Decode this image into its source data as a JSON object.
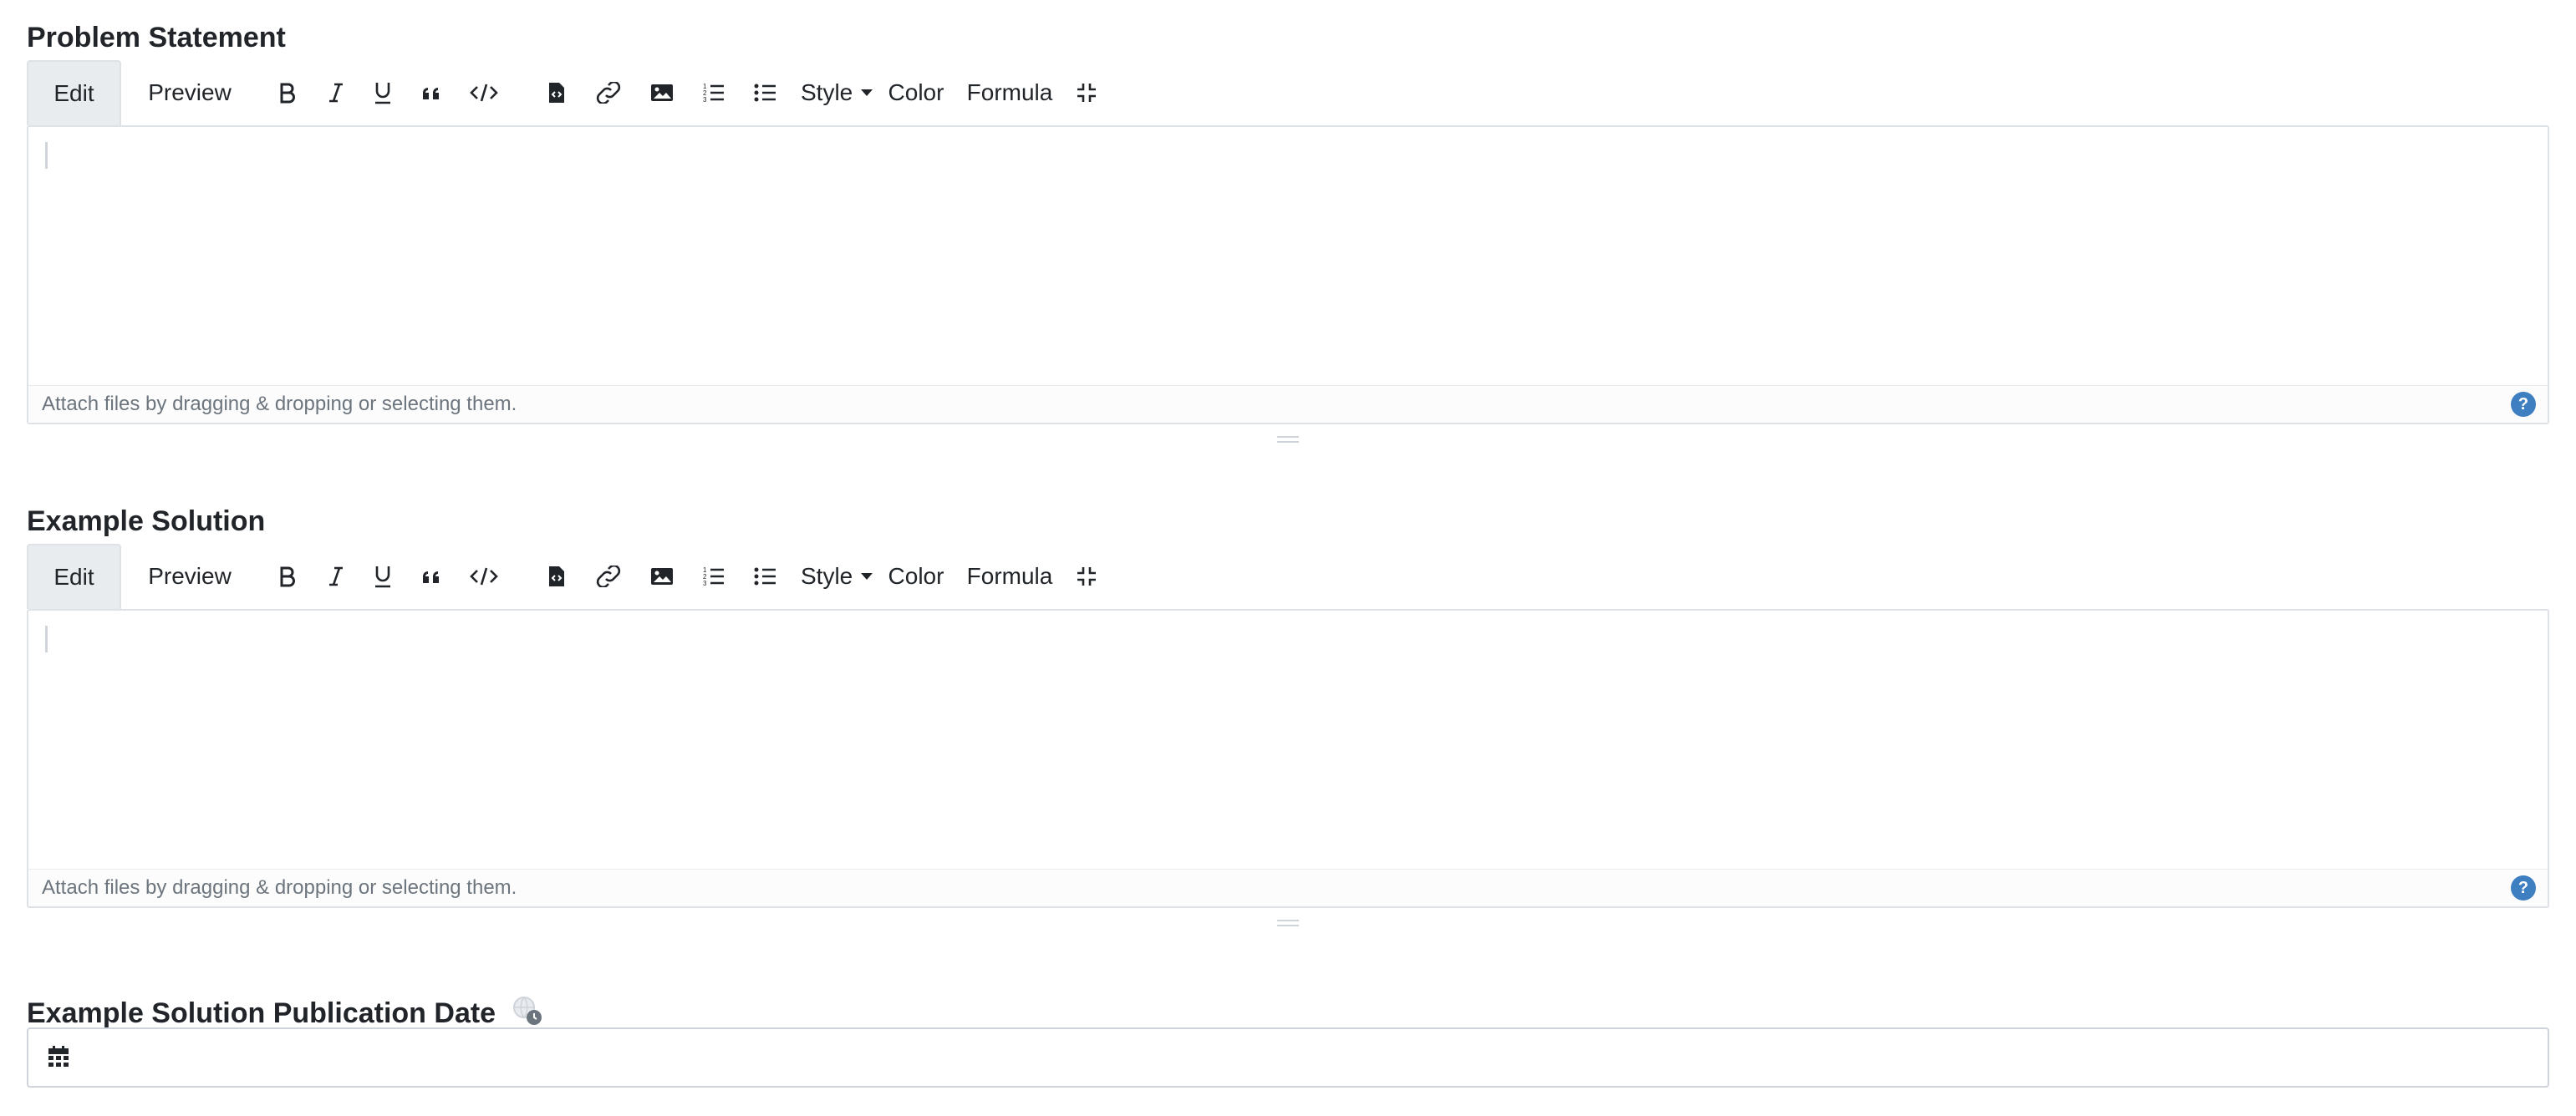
{
  "sections": [
    {
      "title": "Problem Statement",
      "toolbar": {
        "tab_edit": "Edit",
        "tab_preview": "Preview",
        "style_label": "Style",
        "color_label": "Color",
        "formula_label": "Formula"
      },
      "editor": {
        "value": "",
        "footer_text": "Attach files by dragging & dropping or selecting them.",
        "help_label": "?"
      }
    },
    {
      "title": "Example Solution",
      "toolbar": {
        "tab_edit": "Edit",
        "tab_preview": "Preview",
        "style_label": "Style",
        "color_label": "Color",
        "formula_label": "Formula"
      },
      "editor": {
        "value": "",
        "footer_text": "Attach files by dragging & dropping or selecting them.",
        "help_label": "?"
      }
    }
  ],
  "publication_date": {
    "title": "Example Solution Publication Date",
    "value": "",
    "icons": [
      "calendar-icon",
      "globe-clock-icon"
    ]
  },
  "icons": [
    "bold-icon",
    "italic-icon",
    "underline-icon",
    "quote-icon",
    "code-icon",
    "code-block-icon",
    "link-icon",
    "image-icon",
    "ordered-list-icon",
    "unordered-list-icon",
    "caret-down-icon",
    "fullscreen-icon",
    "help-icon"
  ],
  "colors": {
    "text": "#212529",
    "muted": "#6c757d",
    "border": "#dee2e6",
    "help": "#3e7fc1",
    "active_tab": "#e9ecef"
  }
}
